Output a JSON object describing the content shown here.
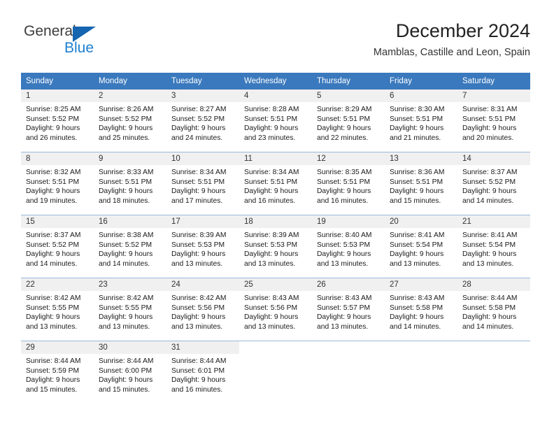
{
  "brand": {
    "word_one": "General",
    "word_two": "Blue",
    "triangle_color": "#1565b0",
    "blue_text_color": "#1d7fd1"
  },
  "header": {
    "title": "December 2024",
    "subtitle": "Mamblas, Castille and Leon, Spain"
  },
  "theme": {
    "header_row_color": "#3a79bd",
    "day_band_color": "#f0f0f0",
    "grid_line_color": "#9bb8d8",
    "text_color": "#1a1a1a"
  },
  "weekdays": [
    "Sunday",
    "Monday",
    "Tuesday",
    "Wednesday",
    "Thursday",
    "Friday",
    "Saturday"
  ],
  "weeks": [
    [
      {
        "day": "1",
        "sunrise": "Sunrise: 8:25 AM",
        "sunset": "Sunset: 5:52 PM",
        "daylight_line1": "Daylight: 9 hours",
        "daylight_line2": "and 26 minutes."
      },
      {
        "day": "2",
        "sunrise": "Sunrise: 8:26 AM",
        "sunset": "Sunset: 5:52 PM",
        "daylight_line1": "Daylight: 9 hours",
        "daylight_line2": "and 25 minutes."
      },
      {
        "day": "3",
        "sunrise": "Sunrise: 8:27 AM",
        "sunset": "Sunset: 5:52 PM",
        "daylight_line1": "Daylight: 9 hours",
        "daylight_line2": "and 24 minutes."
      },
      {
        "day": "4",
        "sunrise": "Sunrise: 8:28 AM",
        "sunset": "Sunset: 5:51 PM",
        "daylight_line1": "Daylight: 9 hours",
        "daylight_line2": "and 23 minutes."
      },
      {
        "day": "5",
        "sunrise": "Sunrise: 8:29 AM",
        "sunset": "Sunset: 5:51 PM",
        "daylight_line1": "Daylight: 9 hours",
        "daylight_line2": "and 22 minutes."
      },
      {
        "day": "6",
        "sunrise": "Sunrise: 8:30 AM",
        "sunset": "Sunset: 5:51 PM",
        "daylight_line1": "Daylight: 9 hours",
        "daylight_line2": "and 21 minutes."
      },
      {
        "day": "7",
        "sunrise": "Sunrise: 8:31 AM",
        "sunset": "Sunset: 5:51 PM",
        "daylight_line1": "Daylight: 9 hours",
        "daylight_line2": "and 20 minutes."
      }
    ],
    [
      {
        "day": "8",
        "sunrise": "Sunrise: 8:32 AM",
        "sunset": "Sunset: 5:51 PM",
        "daylight_line1": "Daylight: 9 hours",
        "daylight_line2": "and 19 minutes."
      },
      {
        "day": "9",
        "sunrise": "Sunrise: 8:33 AM",
        "sunset": "Sunset: 5:51 PM",
        "daylight_line1": "Daylight: 9 hours",
        "daylight_line2": "and 18 minutes."
      },
      {
        "day": "10",
        "sunrise": "Sunrise: 8:34 AM",
        "sunset": "Sunset: 5:51 PM",
        "daylight_line1": "Daylight: 9 hours",
        "daylight_line2": "and 17 minutes."
      },
      {
        "day": "11",
        "sunrise": "Sunrise: 8:34 AM",
        "sunset": "Sunset: 5:51 PM",
        "daylight_line1": "Daylight: 9 hours",
        "daylight_line2": "and 16 minutes."
      },
      {
        "day": "12",
        "sunrise": "Sunrise: 8:35 AM",
        "sunset": "Sunset: 5:51 PM",
        "daylight_line1": "Daylight: 9 hours",
        "daylight_line2": "and 16 minutes."
      },
      {
        "day": "13",
        "sunrise": "Sunrise: 8:36 AM",
        "sunset": "Sunset: 5:51 PM",
        "daylight_line1": "Daylight: 9 hours",
        "daylight_line2": "and 15 minutes."
      },
      {
        "day": "14",
        "sunrise": "Sunrise: 8:37 AM",
        "sunset": "Sunset: 5:52 PM",
        "daylight_line1": "Daylight: 9 hours",
        "daylight_line2": "and 14 minutes."
      }
    ],
    [
      {
        "day": "15",
        "sunrise": "Sunrise: 8:37 AM",
        "sunset": "Sunset: 5:52 PM",
        "daylight_line1": "Daylight: 9 hours",
        "daylight_line2": "and 14 minutes."
      },
      {
        "day": "16",
        "sunrise": "Sunrise: 8:38 AM",
        "sunset": "Sunset: 5:52 PM",
        "daylight_line1": "Daylight: 9 hours",
        "daylight_line2": "and 14 minutes."
      },
      {
        "day": "17",
        "sunrise": "Sunrise: 8:39 AM",
        "sunset": "Sunset: 5:53 PM",
        "daylight_line1": "Daylight: 9 hours",
        "daylight_line2": "and 13 minutes."
      },
      {
        "day": "18",
        "sunrise": "Sunrise: 8:39 AM",
        "sunset": "Sunset: 5:53 PM",
        "daylight_line1": "Daylight: 9 hours",
        "daylight_line2": "and 13 minutes."
      },
      {
        "day": "19",
        "sunrise": "Sunrise: 8:40 AM",
        "sunset": "Sunset: 5:53 PM",
        "daylight_line1": "Daylight: 9 hours",
        "daylight_line2": "and 13 minutes."
      },
      {
        "day": "20",
        "sunrise": "Sunrise: 8:41 AM",
        "sunset": "Sunset: 5:54 PM",
        "daylight_line1": "Daylight: 9 hours",
        "daylight_line2": "and 13 minutes."
      },
      {
        "day": "21",
        "sunrise": "Sunrise: 8:41 AM",
        "sunset": "Sunset: 5:54 PM",
        "daylight_line1": "Daylight: 9 hours",
        "daylight_line2": "and 13 minutes."
      }
    ],
    [
      {
        "day": "22",
        "sunrise": "Sunrise: 8:42 AM",
        "sunset": "Sunset: 5:55 PM",
        "daylight_line1": "Daylight: 9 hours",
        "daylight_line2": "and 13 minutes."
      },
      {
        "day": "23",
        "sunrise": "Sunrise: 8:42 AM",
        "sunset": "Sunset: 5:55 PM",
        "daylight_line1": "Daylight: 9 hours",
        "daylight_line2": "and 13 minutes."
      },
      {
        "day": "24",
        "sunrise": "Sunrise: 8:42 AM",
        "sunset": "Sunset: 5:56 PM",
        "daylight_line1": "Daylight: 9 hours",
        "daylight_line2": "and 13 minutes."
      },
      {
        "day": "25",
        "sunrise": "Sunrise: 8:43 AM",
        "sunset": "Sunset: 5:56 PM",
        "daylight_line1": "Daylight: 9 hours",
        "daylight_line2": "and 13 minutes."
      },
      {
        "day": "26",
        "sunrise": "Sunrise: 8:43 AM",
        "sunset": "Sunset: 5:57 PM",
        "daylight_line1": "Daylight: 9 hours",
        "daylight_line2": "and 13 minutes."
      },
      {
        "day": "27",
        "sunrise": "Sunrise: 8:43 AM",
        "sunset": "Sunset: 5:58 PM",
        "daylight_line1": "Daylight: 9 hours",
        "daylight_line2": "and 14 minutes."
      },
      {
        "day": "28",
        "sunrise": "Sunrise: 8:44 AM",
        "sunset": "Sunset: 5:58 PM",
        "daylight_line1": "Daylight: 9 hours",
        "daylight_line2": "and 14 minutes."
      }
    ],
    [
      {
        "day": "29",
        "sunrise": "Sunrise: 8:44 AM",
        "sunset": "Sunset: 5:59 PM",
        "daylight_line1": "Daylight: 9 hours",
        "daylight_line2": "and 15 minutes."
      },
      {
        "day": "30",
        "sunrise": "Sunrise: 8:44 AM",
        "sunset": "Sunset: 6:00 PM",
        "daylight_line1": "Daylight: 9 hours",
        "daylight_line2": "and 15 minutes."
      },
      {
        "day": "31",
        "sunrise": "Sunrise: 8:44 AM",
        "sunset": "Sunset: 6:01 PM",
        "daylight_line1": "Daylight: 9 hours",
        "daylight_line2": "and 16 minutes."
      },
      {
        "day": "",
        "sunrise": "",
        "sunset": "",
        "daylight_line1": "",
        "daylight_line2": ""
      },
      {
        "day": "",
        "sunrise": "",
        "sunset": "",
        "daylight_line1": "",
        "daylight_line2": ""
      },
      {
        "day": "",
        "sunrise": "",
        "sunset": "",
        "daylight_line1": "",
        "daylight_line2": ""
      },
      {
        "day": "",
        "sunrise": "",
        "sunset": "",
        "daylight_line1": "",
        "daylight_line2": ""
      }
    ]
  ]
}
